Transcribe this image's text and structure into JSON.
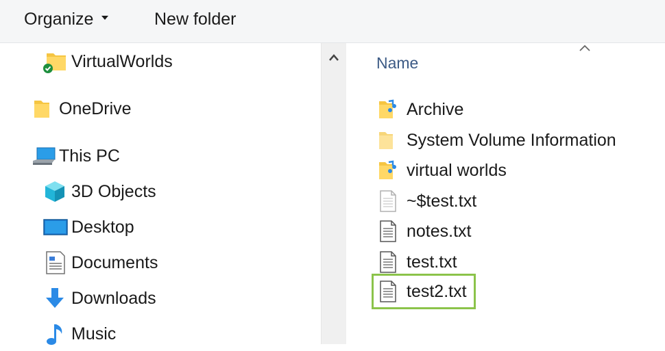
{
  "toolbar": {
    "organize_label": "Organize",
    "new_folder_label": "New folder"
  },
  "nav": {
    "items": [
      {
        "label": "VirtualWorlds",
        "icon": "folder-synced-icon"
      },
      {
        "label": "OneDrive",
        "icon": "onedrive-folder-icon"
      },
      {
        "label": "This PC",
        "icon": "computer-icon"
      },
      {
        "label": "3D Objects",
        "icon": "cube-3d-icon"
      },
      {
        "label": "Desktop",
        "icon": "desktop-icon"
      },
      {
        "label": "Documents",
        "icon": "documents-icon"
      },
      {
        "label": "Downloads",
        "icon": "download-arrow-icon"
      },
      {
        "label": "Music",
        "icon": "music-note-icon"
      }
    ]
  },
  "content": {
    "column_header": "Name",
    "files": [
      {
        "name": "Archive",
        "icon": "folder-shortcut-icon"
      },
      {
        "name": "System Volume Information",
        "icon": "folder-icon"
      },
      {
        "name": "virtual worlds",
        "icon": "folder-shortcut-icon"
      },
      {
        "name": "~$test.txt",
        "icon": "text-file-icon"
      },
      {
        "name": "notes.txt",
        "icon": "text-file-icon"
      },
      {
        "name": "test.txt",
        "icon": "text-file-icon"
      },
      {
        "name": "test2.txt",
        "icon": "text-file-icon",
        "highlighted": true
      }
    ]
  },
  "colors": {
    "toolbar_bg": "#f5f6f7",
    "folder_yellow": "#f5c542",
    "header_blue": "#3c5a85",
    "highlight_green": "#8bc34a",
    "scrollbar_bg": "#f0f0f0"
  }
}
